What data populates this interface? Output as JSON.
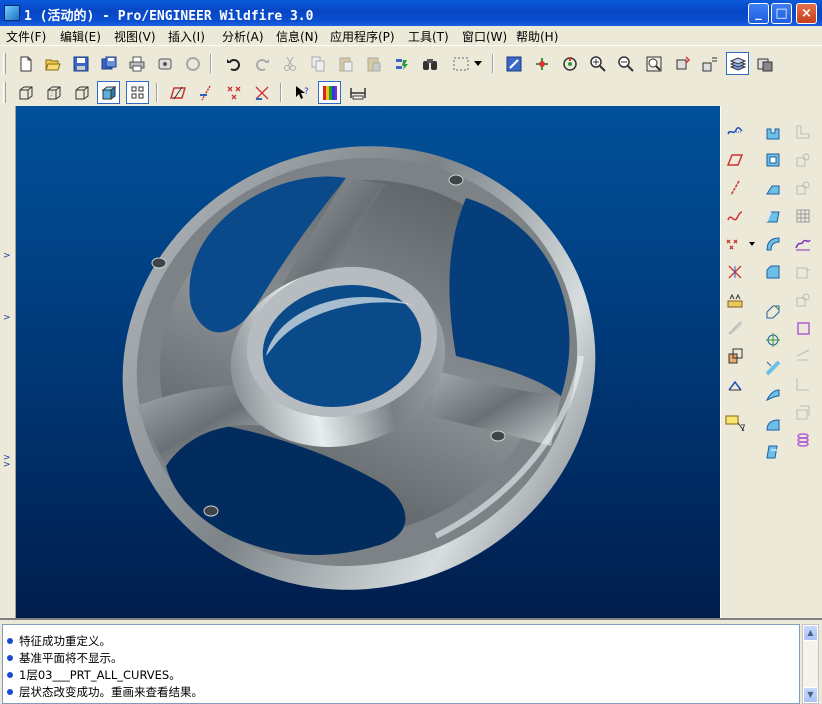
{
  "window": {
    "title": "1 (活动的) - Pro/ENGINEER Wildfire 3.0",
    "minimize": "_",
    "maximize": "□",
    "close": "×"
  },
  "menu": [
    "文件(F)",
    "编辑(E)",
    "视图(V)",
    "插入(I)",
    "分析(A)",
    "信息(N)",
    "应用程序(P)",
    "工具(T)",
    "窗口(W)",
    "帮助(H)"
  ],
  "toolbar1_icons": [
    "new-file-icon",
    "open-file-icon",
    "save-icon",
    "save-copy-icon",
    "print-icon",
    "email-icon",
    "email-link-icon",
    "undo-icon",
    "redo-icon",
    "cut-icon",
    "copy-icon",
    "paste-icon",
    "paste-special-icon",
    "regenerate-icon",
    "find-icon",
    "select-box-icon",
    "dropdown-arrow-icon",
    "repaint-icon",
    "spin-center-icon",
    "orient-mode-icon",
    "zoom-in-icon",
    "zoom-out-icon",
    "refit-icon",
    "reorient-icon",
    "saved-views-icon",
    "layers-icon",
    "view-manager-icon"
  ],
  "toolbar2_icons": [
    "wireframe-icon",
    "hidden-line-icon",
    "no-hidden-icon",
    "shading-icon",
    "datum-planes-icon",
    "datum-axes-icon",
    "datum-points-icon",
    "csys-icon",
    "whats-this-icon",
    "color-appearance-icon",
    "measure-icon"
  ],
  "right_icons_col1": [
    "datum-plane-icon",
    "datum-axis-icon",
    "datum-curve-icon",
    "datum-point-icon",
    "csys-datum-icon",
    "analysis-icon",
    "sketch-icon",
    "feature-sep-icon",
    "note-icon"
  ],
  "messages": [
    "特征成功重定义。",
    "基准平面将不显示。",
    "1层03___PRT_ALL_CURVES。",
    "层状态改变成功。重画来查看结果。"
  ],
  "colors": {
    "title_bar": "#0a4fd0",
    "viewport_top": "#02519a",
    "viewport_bottom": "#001d4c",
    "model": "#8a8f92"
  }
}
